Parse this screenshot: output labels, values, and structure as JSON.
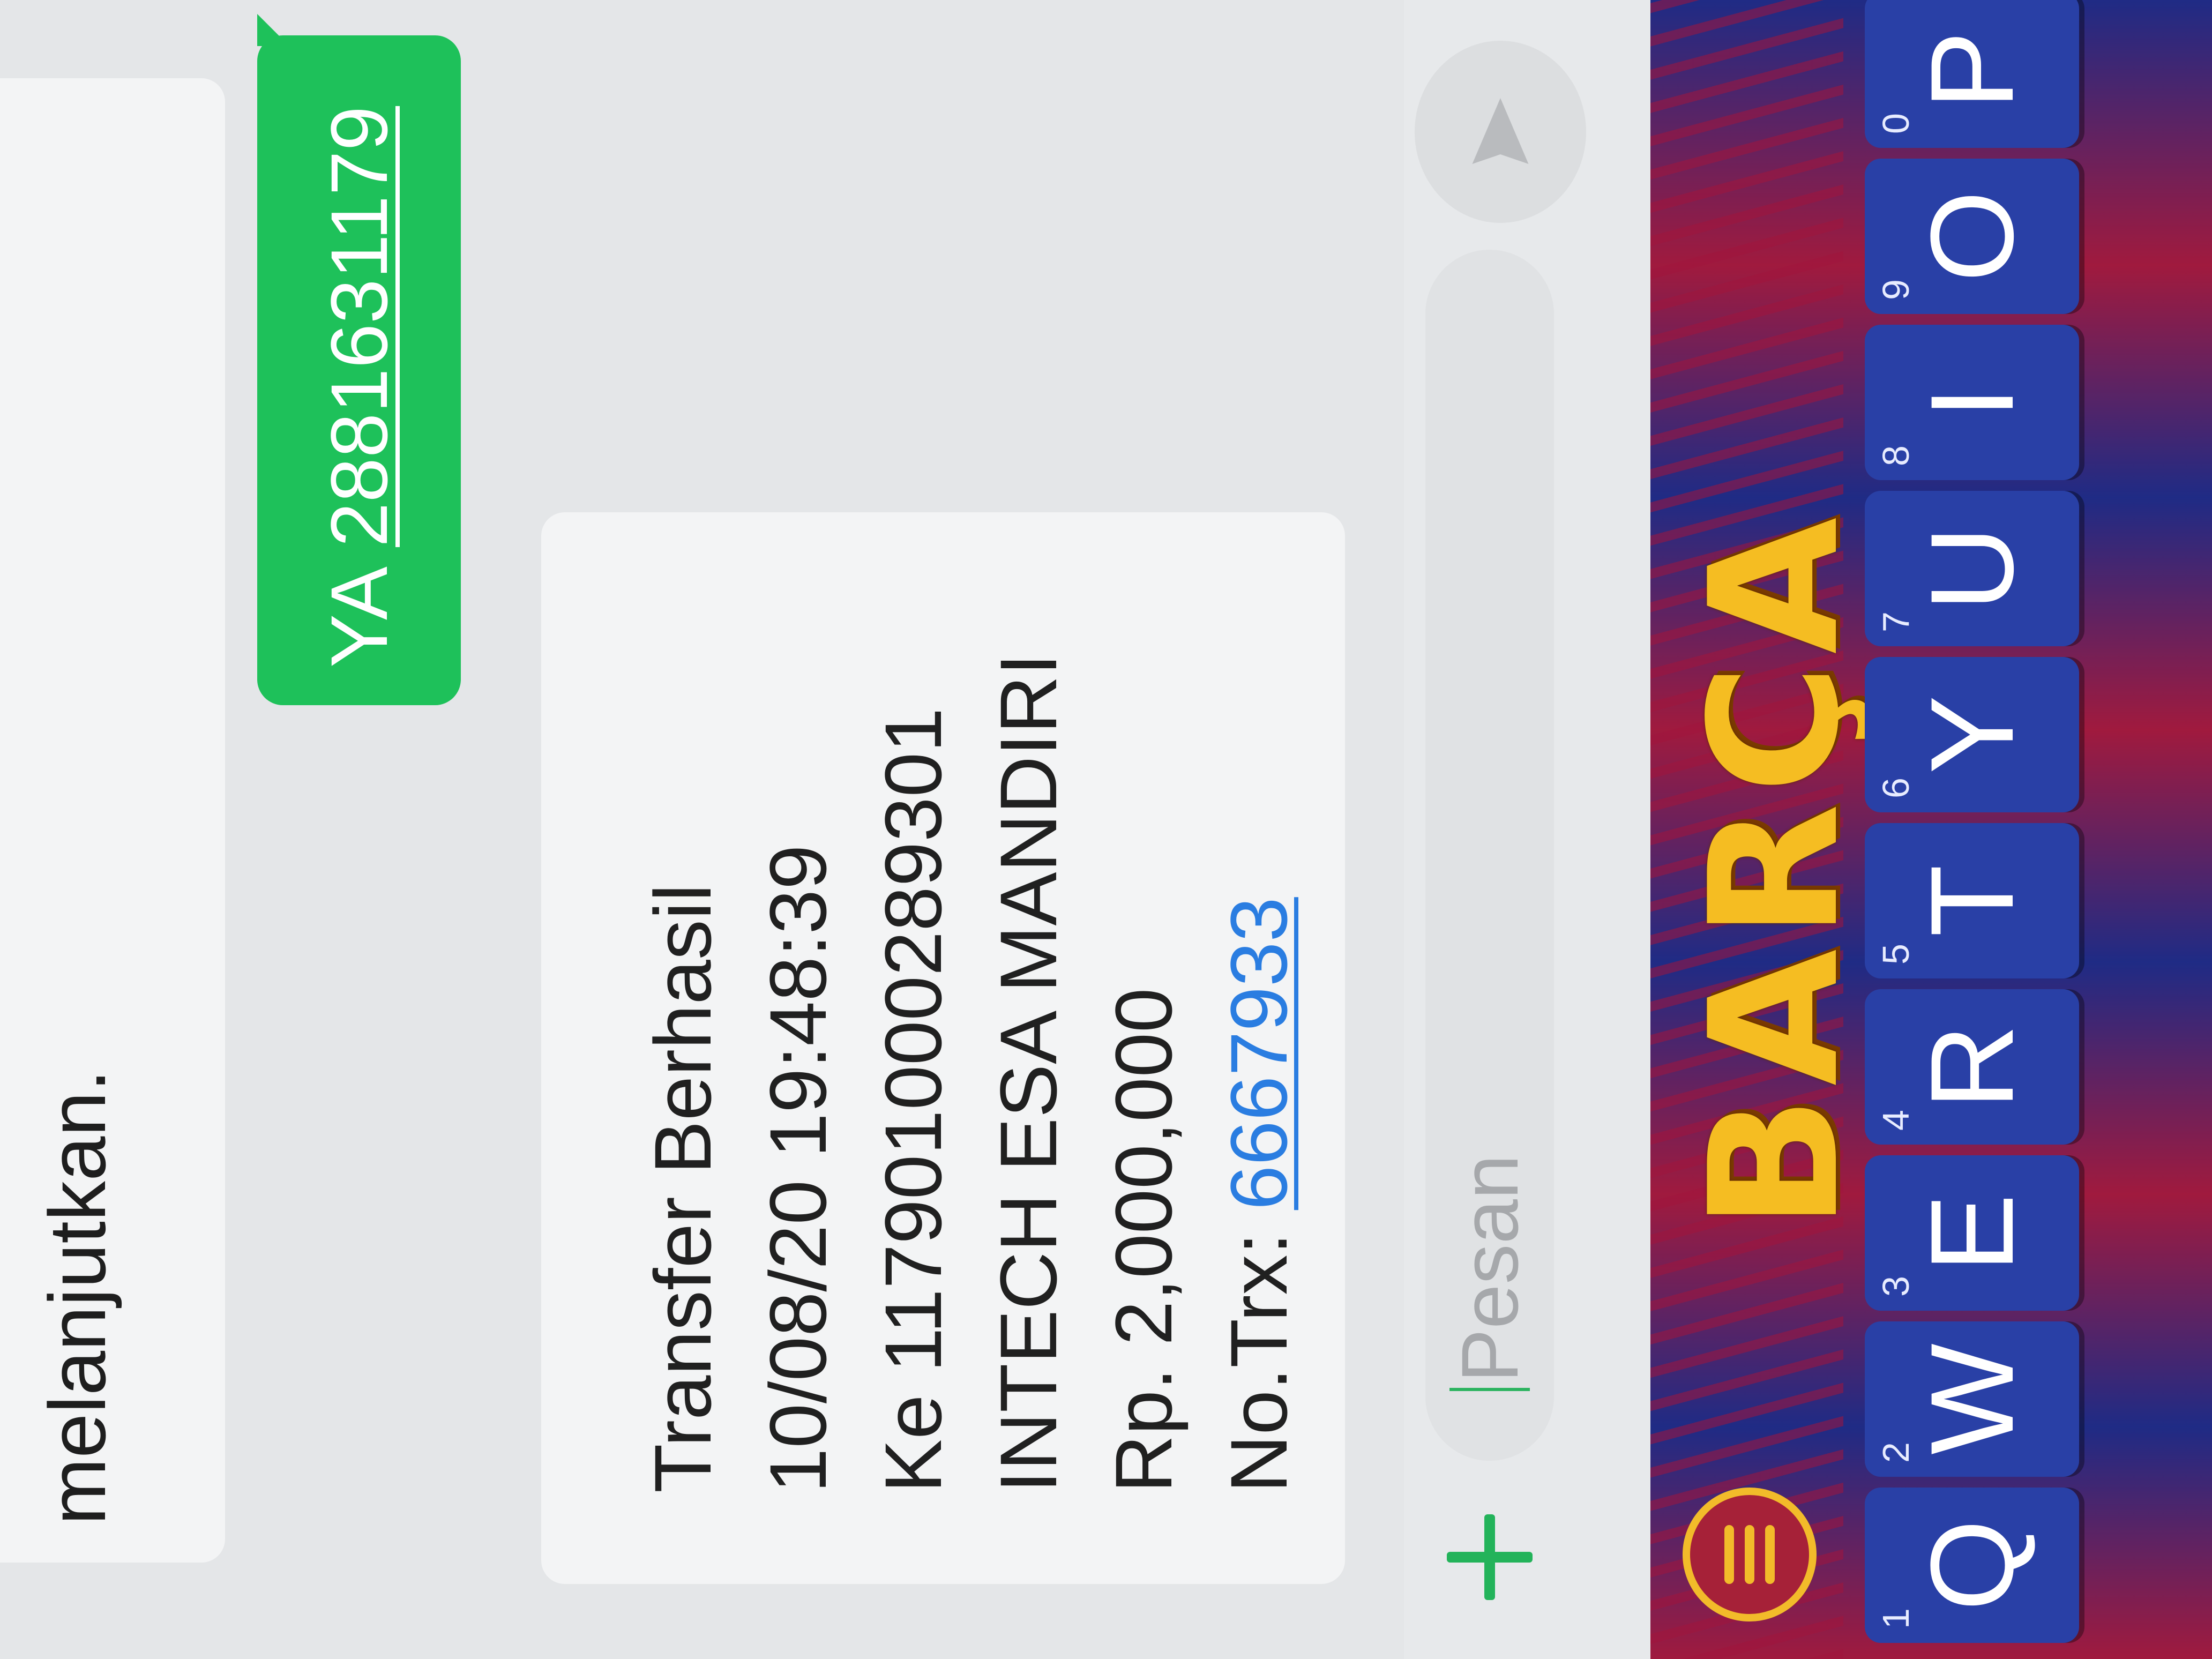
{
  "conversation": {
    "previous_message_tail": "melanjutkan.",
    "sent_message": {
      "prefix": "YA",
      "code": "2881631179"
    },
    "received_message": {
      "title": "Transfer Berhasil",
      "datetime": "10/08/20 19:48:39",
      "destination": "Ke 117901000289301",
      "recipient_name": "INTECH ESA MANDIRI",
      "amount": "Rp. 2,000,000",
      "trx_label": "No.Trx:",
      "trx_number": "6667933"
    }
  },
  "compose": {
    "placeholder": "Pesan",
    "add_icon": "plus-icon",
    "send_icon": "send-icon"
  },
  "keyboard": {
    "logo": "BARÇA",
    "menu_icon": "menu-icon",
    "keys": [
      {
        "letter": "Q",
        "number": "1"
      },
      {
        "letter": "W",
        "number": "2"
      },
      {
        "letter": "E",
        "number": "3"
      },
      {
        "letter": "R",
        "number": "4"
      },
      {
        "letter": "T",
        "number": "5"
      },
      {
        "letter": "Y",
        "number": "6"
      },
      {
        "letter": "U",
        "number": "7"
      },
      {
        "letter": "I",
        "number": "8"
      },
      {
        "letter": "O",
        "number": "9"
      },
      {
        "letter": "P",
        "number": "0"
      }
    ]
  },
  "colors": {
    "sent_bubble": "#1ec15a",
    "link": "#2a7de1",
    "keyboard_key": "#2940a6",
    "logo_gold": "#f5bd22"
  }
}
